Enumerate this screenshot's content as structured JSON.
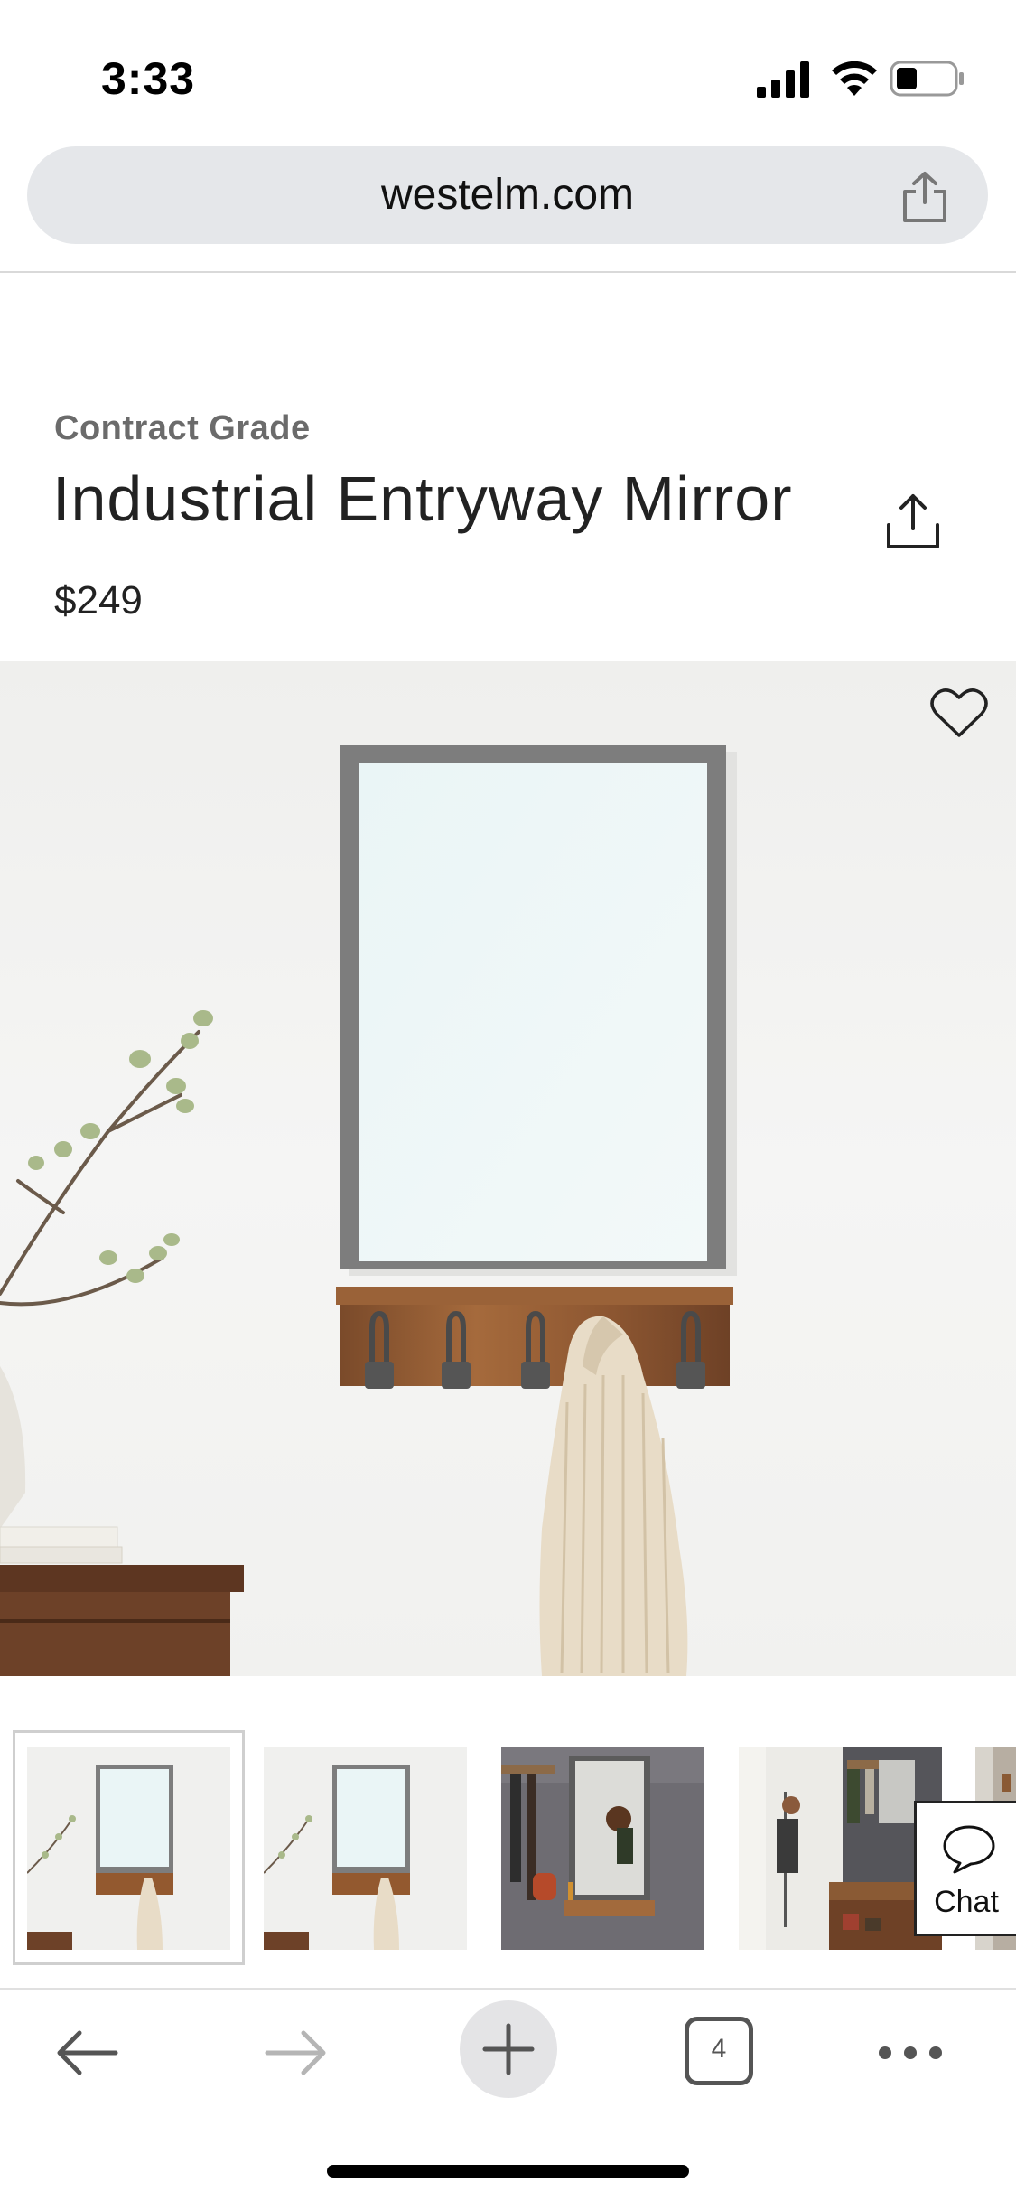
{
  "status_bar": {
    "time": "3:33"
  },
  "browser": {
    "url": "westelm.com",
    "tab_count": "4"
  },
  "product": {
    "brand_line": "Contract Grade",
    "title": "Industrial Entryway Mirror",
    "price": "$249"
  },
  "chat": {
    "label": "Chat"
  },
  "icons": {
    "url_share": "share-icon",
    "title_share": "share-icon",
    "favorite": "heart-icon",
    "chat": "speech-bubble-icon",
    "back": "arrow-left-icon",
    "forward": "arrow-right-icon",
    "new_tab": "plus-icon",
    "tabs": "tabs-icon",
    "more": "more-icon"
  },
  "colors": {
    "url_bar_bg": "#e5e7ea",
    "new_tab_bg": "#e4e4e6",
    "text_primary": "#222222",
    "text_secondary": "#6b6b6b"
  }
}
